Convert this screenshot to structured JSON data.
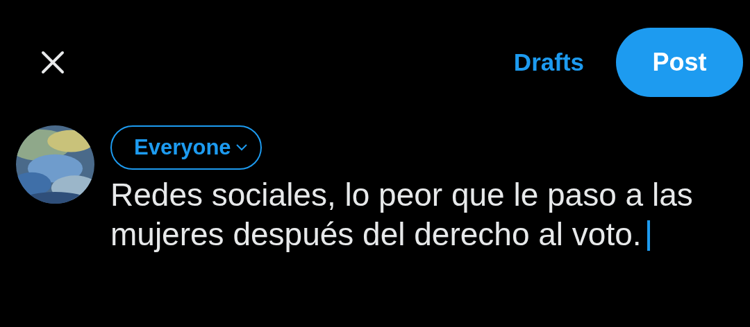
{
  "header": {
    "drafts": "Drafts",
    "post_button": "Post"
  },
  "audience": {
    "label": "Everyone"
  },
  "composer": {
    "value": "Redes sociales, lo peor que le paso a las mujeres después del derecho al voto.",
    "focused": true
  }
}
